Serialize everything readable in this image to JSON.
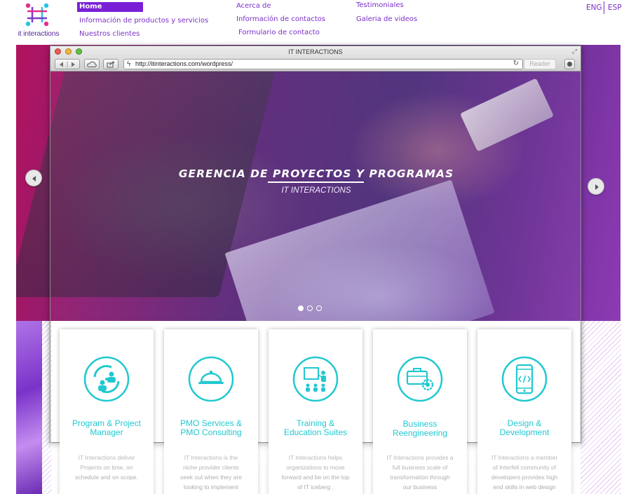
{
  "logo": {
    "text": "it interactions",
    "icon": "network-logo-icon"
  },
  "nav": {
    "home": "Home",
    "products": "Información de productos y servicios",
    "clients": "Nuestros clientes",
    "about": "Acerca de",
    "contacts": "Información de contactos",
    "form": "Formulario de contacto",
    "testimonials": "Testimoniales",
    "videos": "Galeria de videos"
  },
  "languages": {
    "eng": "ENG",
    "esp": "ESP"
  },
  "browser": {
    "title": "IT INTERACTIONS",
    "url": "http://itinteractions.com/wordpress/",
    "reader": "Reader"
  },
  "slide": {
    "title": "GERENCIA DE PROYECTOS Y PROGRAMAS",
    "subtitle": "IT INTERACTIONS",
    "active_index": 1,
    "count": 3
  },
  "colors": {
    "accent": "#7a1fd6",
    "teal": "#21c8d0",
    "nav_text": "#7b2fc9"
  },
  "services": [
    {
      "title_line1": "Program & Project",
      "title_line2": "Manager",
      "icon": "people-network-icon",
      "desc": [
        "IT Interactions deliver",
        "Projects on time, on",
        "schedule and on scope."
      ]
    },
    {
      "title_line1": "PMO Services &",
      "title_line2": "PMO Consulting",
      "icon": "service-bell-icon",
      "desc": [
        "IT Interactions is the",
        "niche provider clients",
        "seek out when they are",
        "looking to implement"
      ]
    },
    {
      "title_line1": "Training &",
      "title_line2": "Education Suites",
      "icon": "presentation-training-icon",
      "desc": [
        "IT Interactions helps",
        "organizations to move",
        "forward and be on the top",
        "of IT iceberg ."
      ]
    },
    {
      "title_line1": "Business",
      "title_line2": "Reengineering",
      "icon": "briefcase-gear-icon",
      "desc": [
        "IT Interactions provides a",
        "full business scale of",
        "transformation through",
        "our business"
      ]
    },
    {
      "title_line1": "Design &",
      "title_line2": "Development",
      "icon": "mobile-code-icon",
      "desc": [
        "IT Interactions a member",
        "of Interfell community of",
        "developers provides high",
        "end skills in web design"
      ]
    }
  ]
}
